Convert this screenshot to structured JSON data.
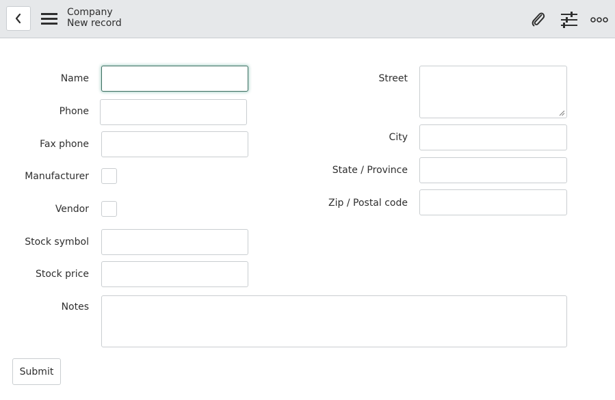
{
  "header": {
    "title": "Company",
    "subtitle": "New record",
    "background": "#e6e8ea",
    "icons": {
      "back": "chevron-left-icon",
      "menu": "hamburger-menu-icon",
      "attach": "paperclip-icon",
      "settings": "sliders-icon",
      "more": "more-options-icon"
    }
  },
  "form": {
    "left": {
      "name": {
        "label": "Name",
        "value": "",
        "focused": true
      },
      "phone": {
        "label": "Phone",
        "value": ""
      },
      "fax_phone": {
        "label": "Fax phone",
        "value": ""
      },
      "manufacturer": {
        "label": "Manufacturer",
        "checked": false
      },
      "vendor": {
        "label": "Vendor",
        "checked": false
      },
      "stock_symbol": {
        "label": "Stock symbol",
        "value": ""
      },
      "stock_price": {
        "label": "Stock price",
        "value": ""
      }
    },
    "right": {
      "street": {
        "label": "Street",
        "value": ""
      },
      "city": {
        "label": "City",
        "value": ""
      },
      "state": {
        "label": "State / Province",
        "value": ""
      },
      "zip": {
        "label": "Zip / Postal code",
        "value": ""
      }
    },
    "notes": {
      "label": "Notes",
      "value": ""
    },
    "submit_label": "Submit"
  },
  "colors": {
    "focus_border": "#3c6e60",
    "field_border": "#c9cdd0",
    "text": "#2e2e2e"
  }
}
